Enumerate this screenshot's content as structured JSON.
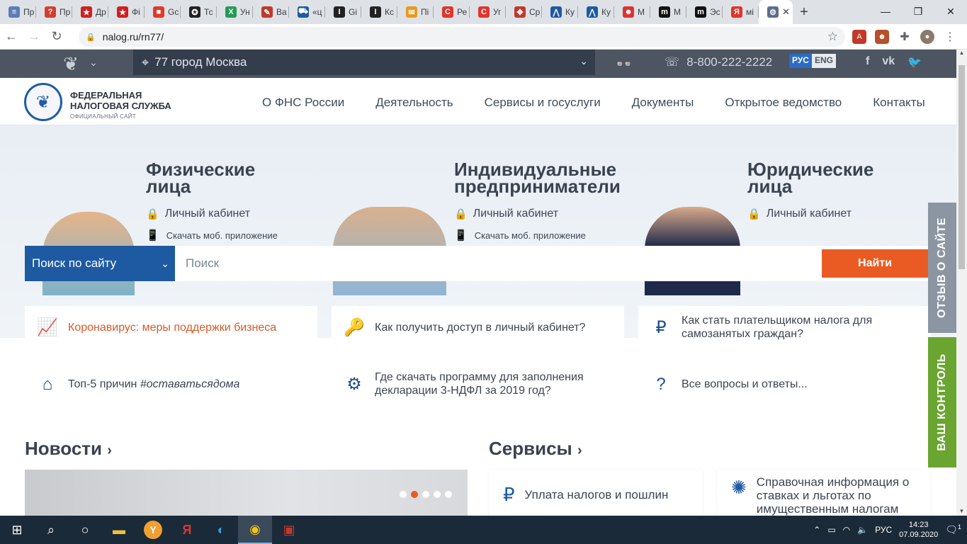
{
  "browser": {
    "tabs": [
      {
        "label": "Пр",
        "color": "#5b7db8",
        "glyph": "≡"
      },
      {
        "label": "Пр",
        "color": "#d23f31",
        "glyph": "?"
      },
      {
        "label": "Др",
        "color": "#d01f1f",
        "glyph": "★"
      },
      {
        "label": "Фі",
        "color": "#d01f1f",
        "glyph": "★"
      },
      {
        "label": "Gc",
        "color": "#e2382a",
        "glyph": "■"
      },
      {
        "label": "Тс",
        "color": "#222222",
        "glyph": "✪"
      },
      {
        "label": "Ун",
        "color": "#1f9d55",
        "glyph": "X"
      },
      {
        "label": "Ва",
        "color": "#c0392b",
        "glyph": "✎"
      },
      {
        "label": "«ц",
        "color": "#1e5aa1",
        "glyph": "⛟"
      },
      {
        "label": "Gi",
        "color": "#222222",
        "glyph": "I"
      },
      {
        "label": "Кс",
        "color": "#222222",
        "glyph": "I"
      },
      {
        "label": "Пі",
        "color": "#e79b1c",
        "glyph": "✉"
      },
      {
        "label": "Ре",
        "color": "#e0352b",
        "glyph": "C"
      },
      {
        "label": "Уг",
        "color": "#e0352b",
        "glyph": "C"
      },
      {
        "label": "Ср",
        "color": "#c0392b",
        "glyph": "✥"
      },
      {
        "label": "Ку",
        "color": "#1e5aa1",
        "glyph": "⋀"
      },
      {
        "label": "Ку",
        "color": "#1e5aa1",
        "glyph": "⋀"
      },
      {
        "label": "М",
        "color": "#d33",
        "glyph": "☻"
      },
      {
        "label": "М",
        "color": "#111111",
        "glyph": "m"
      },
      {
        "label": "Эс",
        "color": "#111111",
        "glyph": "m"
      },
      {
        "label": "мі",
        "color": "#e0352b",
        "glyph": "Я"
      }
    ],
    "active_tab": {
      "color": "#5a6e8c",
      "glyph": "⚙"
    },
    "url": "nalog.ru/rn77/"
  },
  "site": {
    "region": "77 город Москва",
    "phone": "8-800-222-2222",
    "lang_ru": "РУС",
    "lang_en": "ENG",
    "social": [
      "f",
      "vk",
      "tw"
    ],
    "logo_line1": "ФЕДЕРАЛЬНАЯ",
    "logo_line2": "НАЛОГОВАЯ СЛУЖБА",
    "logo_sub": "ОФИЦИАЛЬНЫЙ САЙТ",
    "nav": [
      "О ФНС России",
      "Деятельность",
      "Сервисы и госуслуги",
      "Документы",
      "Открытое ведомство",
      "Контакты"
    ],
    "segments": [
      {
        "title1": "Физические",
        "title2": "лица",
        "cabinet": "Личный кабинет",
        "app": "Скачать моб. приложение"
      },
      {
        "title1": "Индивидуальные",
        "title2": "предприниматели",
        "cabinet": "Личный кабинет",
        "app": "Скачать моб. приложение"
      },
      {
        "title1": "Юридические",
        "title2": "лица",
        "cabinet": "Личный кабинет",
        "app": ""
      }
    ],
    "search": {
      "scope": "Поиск по сайту",
      "placeholder": "Поиск",
      "button": "Найти"
    },
    "quick_links": [
      {
        "text": "Коронавирус: меры поддержки бизнеса",
        "icon": "chart-icon"
      },
      {
        "text": "Как получить доступ в личный кабинет?",
        "icon": "key-icon"
      },
      {
        "text": "Как стать плательщиком налога для самозанятых граждан?",
        "icon": "person-ruble-icon"
      },
      {
        "text": "Топ-5 причин #оставатьсядома",
        "text_plain": "Топ-5 причин ",
        "text_italic": "#оставатьсядома",
        "icon": "house-icon"
      },
      {
        "text": "Где скачать программу для заполнения декларации 3-НДФЛ за 2019 год?",
        "icon": "gear-stack-icon"
      },
      {
        "text": "Все вопросы и ответы...",
        "icon": "question-icon"
      }
    ],
    "news_title": "Новости",
    "services_title": "Сервисы",
    "services": [
      {
        "text": "Уплата налогов и пошлин",
        "icon": "phone-ruble-icon"
      },
      {
        "text": "Справочная информация о ставках и льготах по имущественным налогам",
        "icon": "network-icon"
      }
    ],
    "side_feedback": "ОТЗЫВ О САЙТЕ",
    "side_control": "ВАШ КОНТРОЛЬ"
  },
  "taskbar": {
    "lang": "РУС",
    "time": "14:23",
    "date": "07.09.2020",
    "notifications": "1"
  }
}
